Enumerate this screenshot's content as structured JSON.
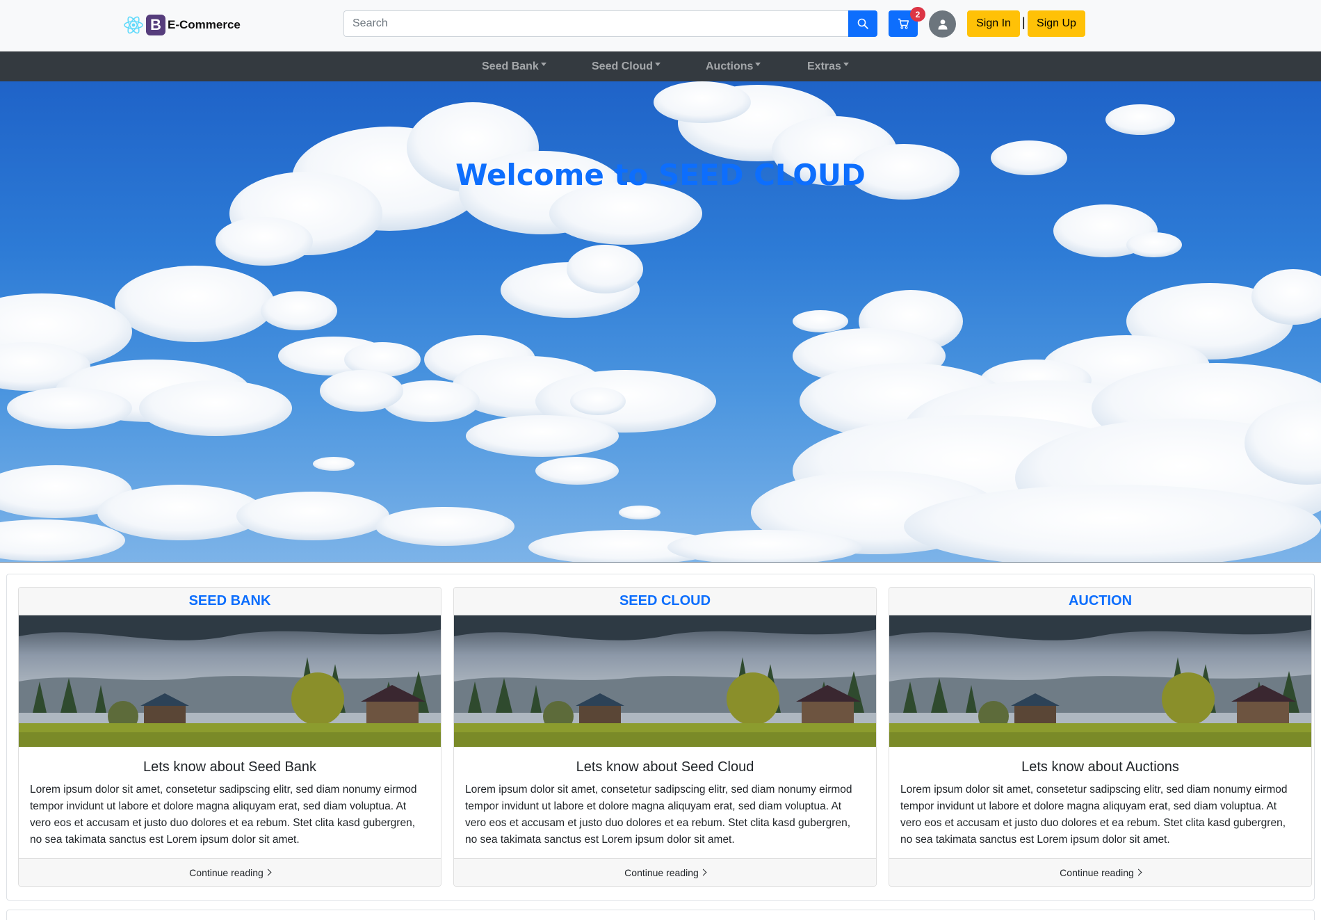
{
  "header": {
    "brand_letter": "B",
    "brand_name": "E-Commerce",
    "search_placeholder": "Search",
    "cart_count": "2",
    "sign_in_label": "Sign In",
    "separator": "|",
    "sign_up_label": "Sign Up",
    "accent_color": "#0d6efd",
    "button_color": "#ffc107"
  },
  "nav": {
    "items": [
      {
        "label": "Seed Bank"
      },
      {
        "label": "Seed Cloud"
      },
      {
        "label": "Auctions"
      },
      {
        "label": "Extras"
      }
    ]
  },
  "hero": {
    "title": "Welcome to SEED CLOUD"
  },
  "cards": [
    {
      "header": "SEED BANK",
      "title": "Lets know about Seed Bank",
      "text": "Lorem ipsum dolor sit amet, consetetur sadipscing elitr, sed diam nonumy eirmod tempor invidunt ut labore et dolore magna aliquyam erat, sed diam voluptua. At vero eos et accusam et justo duo dolores et ea rebum. Stet clita kasd gubergren, no sea takimata sanctus est Lorem ipsum dolor sit amet.",
      "footer": "Continue reading"
    },
    {
      "header": "SEED CLOUD",
      "title": "Lets know about Seed Cloud",
      "text": "Lorem ipsum dolor sit amet, consetetur sadipscing elitr, sed diam nonumy eirmod tempor invidunt ut labore et dolore magna aliquyam erat, sed diam voluptua. At vero eos et accusam et justo duo dolores et ea rebum. Stet clita kasd gubergren, no sea takimata sanctus est Lorem ipsum dolor sit amet.",
      "footer": "Continue reading"
    },
    {
      "header": "AUCTION",
      "title": "Lets know about Auctions",
      "text": "Lorem ipsum dolor sit amet, consetetur sadipscing elitr, sed diam nonumy eirmod tempor invidunt ut labore et dolore magna aliquyam erat, sed diam voluptua. At vero eos et accusam et justo duo dolores et ea rebum. Stet clita kasd gubergren, no sea takimata sanctus est Lorem ipsum dolor sit amet.",
      "footer": "Continue reading"
    }
  ]
}
